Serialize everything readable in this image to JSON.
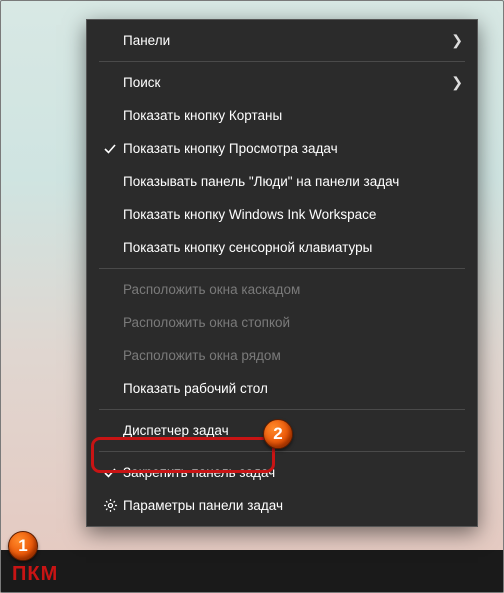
{
  "menu": {
    "panels": "Панели",
    "search": "Поиск",
    "show_cortana": "Показать кнопку Кортаны",
    "show_taskview": "Показать кнопку Просмотра задач",
    "show_people": "Показывать панель \"Люди\" на панели задач",
    "show_ink": "Показать кнопку Windows Ink Workspace",
    "show_touchkb": "Показать кнопку сенсорной клавиатуры",
    "cascade": "Расположить окна каскадом",
    "stack": "Расположить окна стопкой",
    "sidebyside": "Расположить окна рядом",
    "show_desktop": "Показать рабочий стол",
    "task_manager": "Диспетчер задач",
    "lock_taskbar": "Закрепить панель задач",
    "taskbar_settings": "Параметры панели задач"
  },
  "annotations": {
    "callout1": "1",
    "callout2": "2",
    "pkm": "ПКМ"
  }
}
